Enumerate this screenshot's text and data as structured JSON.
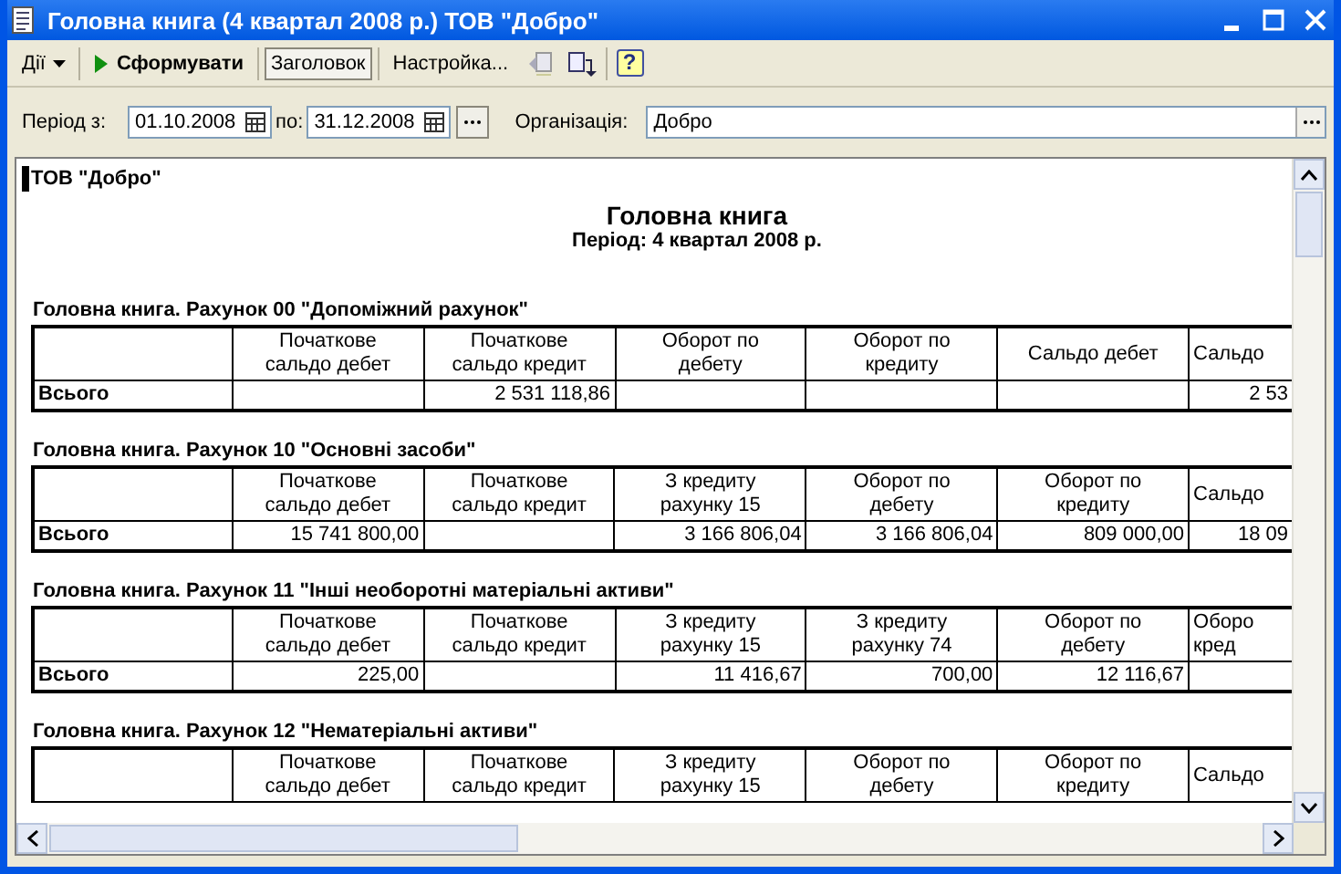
{
  "window": {
    "title": "Головна книга (4 квартал 2008 р.) ТОВ \"Добро\""
  },
  "toolbar": {
    "actions_menu": "Дії",
    "generate_button": "Сформувати",
    "header_toggle": {
      "label": "Заголовок",
      "selected": true
    },
    "settings_button": "Настройка...",
    "help_button": "?"
  },
  "filters": {
    "period_from_label": "Період з:",
    "period_from": "01.10.2008",
    "period_to_label": "по:",
    "period_to": "31.12.2008",
    "organization_label": "Організація:",
    "organization": "Добро"
  },
  "report": {
    "company": "ТОВ \"Добро\"",
    "title": "Головна книга",
    "period": "Період: 4 квартал 2008 р.",
    "sections": [
      {
        "title": "Головна книга. Рахунок 00 \"Допоміжний рахунок\"",
        "columns": [
          "Початкове сальдо дебет",
          "Початкове сальдо кредит",
          "Оборот по дебету",
          "Оборот по кредиту",
          "Сальдо дебет",
          "Сальдо"
        ],
        "total_row": {
          "label": "Всього",
          "values": {
            "c2": "2 531 118,86",
            "c6": "2 53"
          }
        }
      },
      {
        "title": "Головна книга. Рахунок 10 \"Основні засоби\"",
        "columns": [
          "Початкове сальдо дебет",
          "Початкове сальдо кредит",
          "З кредиту рахунку 15",
          "Оборот по дебету",
          "Оборот по кредиту",
          "Сальдо"
        ],
        "total_row": {
          "label": "Всього",
          "values": {
            "c1": "15 741 800,00",
            "c3": "3 166 806,04",
            "c4": "3 166 806,04",
            "c5": "809 000,00",
            "c6": "18 09"
          }
        }
      },
      {
        "title": "Головна книга. Рахунок 11 \"Інші необоротні матеріальні активи\"",
        "columns": [
          "Початкове сальдо дебет",
          "Початкове сальдо кредит",
          "З кредиту рахунку 15",
          "З кредиту рахунку 74",
          "Оборот по дебету",
          "Оборо кред"
        ],
        "total_row": {
          "label": "Всього",
          "values": {
            "c1": "225,00",
            "c3": "11 416,67",
            "c4": "700,00",
            "c5": "12 116,67"
          }
        }
      },
      {
        "title": "Головна книга. Рахунок 12 \"Нематеріальні активи\"",
        "columns": [
          "Початкове сальдо дебет",
          "Початкове сальдо кредит",
          "З кредиту рахунку 15",
          "Оборот по дебету",
          "Оборот по кредиту",
          "Сальдо"
        ]
      }
    ]
  }
}
